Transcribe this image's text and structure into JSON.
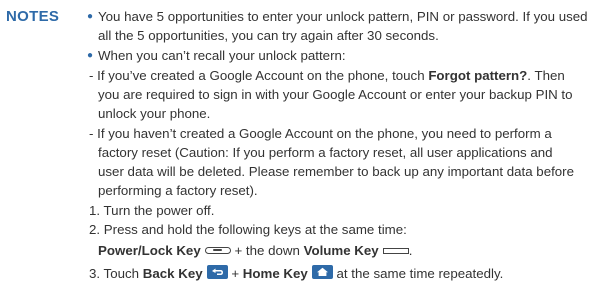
{
  "accent_color": "#2e6aa8",
  "notes_label": "NOTES",
  "bullet1": {
    "line1": "You have 5 opportunities to enter your unlock pattern, PIN or password. If you used",
    "line2": "all the 5 opportunities, you can try again after 30 seconds."
  },
  "bullet2": {
    "heading": "When you can’t recall your unlock pattern:",
    "sub1": {
      "line1_pre": "- If you’ve created a Google Account on the phone, touch ",
      "line1_strong": "Forgot pattern?",
      "line1_post": ". Then",
      "line2": "you are required to sign in with your Google Account or enter your backup PIN to",
      "line3": "unlock your phone."
    },
    "sub2": {
      "line1": "- If you haven’t created a Google Account on the phone, you need to perform a",
      "line2": "factory reset (Caution: If you perform a factory reset, all user applications and",
      "line3": "user data will be deleted. Please remember to back up any important data before",
      "line4": "performing a factory reset)."
    },
    "steps": {
      "s1": "1. Turn the power off.",
      "s2": "2. Press and hold the following keys at the same time:",
      "s2_power_key": "Power/Lock Key",
      "s2_mid": "+ the down",
      "s2_volume_key": "Volume Key",
      "s2_end": ".",
      "s3_pre": "3. Touch",
      "s3_back_key": "Back Key",
      "s3_plus": "+",
      "s3_home_key": "Home Key",
      "s3_post": "at the same time repeatedly."
    }
  },
  "icons": {
    "power_key": "power-lock-key-icon",
    "volume_key": "volume-key-icon",
    "back_key": "back-key-icon",
    "home_key": "home-key-icon"
  }
}
